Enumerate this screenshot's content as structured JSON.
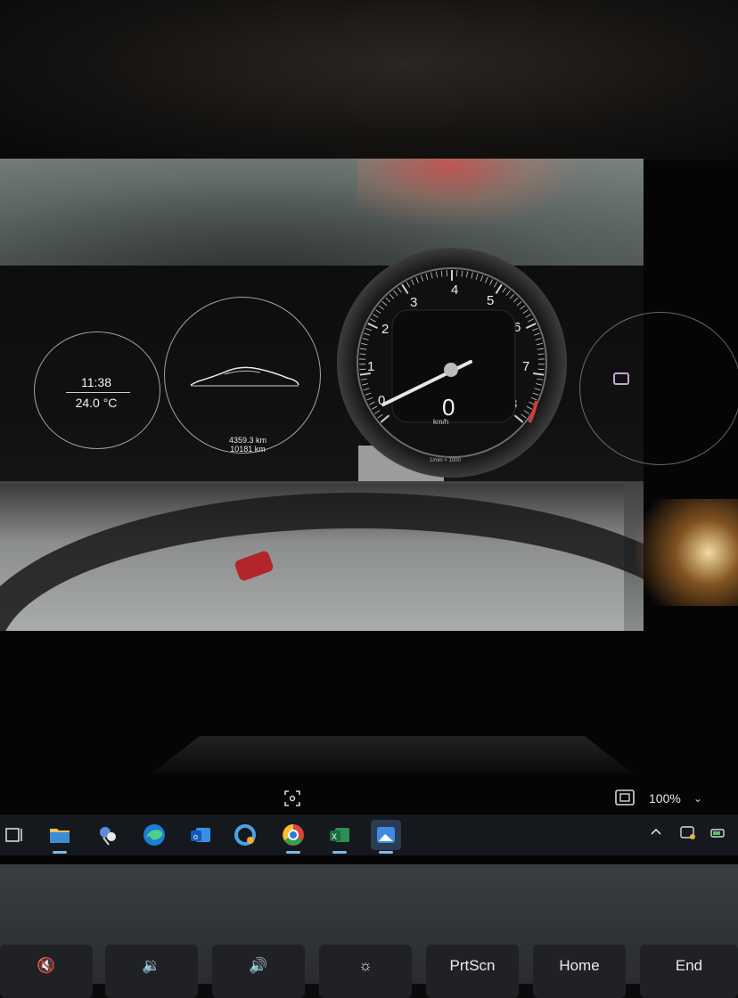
{
  "photo": {
    "clock": {
      "time": "11:38",
      "temperature": "24.0 °C"
    },
    "odometer": {
      "trip": "4359.3 km",
      "total": "10181 km"
    },
    "tachometer": {
      "numbers": [
        "0",
        "1",
        "2",
        "3",
        "4",
        "5",
        "6",
        "7",
        "8"
      ],
      "speed_value": "0",
      "speed_unit": "km/h",
      "rpm_unit": "1/min × 1000"
    }
  },
  "viewer": {
    "zoom": "100%"
  },
  "taskbar": {
    "apps": [
      "task-view",
      "file-explorer",
      "snipping-tool",
      "edge",
      "outlook",
      "copilot",
      "chrome",
      "excel",
      "photos"
    ],
    "active": "photos"
  },
  "keyboard": {
    "keys": [
      {
        "name": "mute-key",
        "label": "🔇"
      },
      {
        "name": "volume-down-key",
        "label": "🔉"
      },
      {
        "name": "volume-up-key",
        "label": "🔊"
      },
      {
        "name": "brightness-key",
        "label": "☼"
      },
      {
        "name": "prtscn-key",
        "label": "PrtScn"
      },
      {
        "name": "home-key",
        "label": "Home"
      },
      {
        "name": "end-key",
        "label": "End"
      }
    ]
  },
  "colors": {
    "taskbar": "#15181c",
    "accent": "#86b8e6",
    "tach_redline": "#d43a3a"
  }
}
